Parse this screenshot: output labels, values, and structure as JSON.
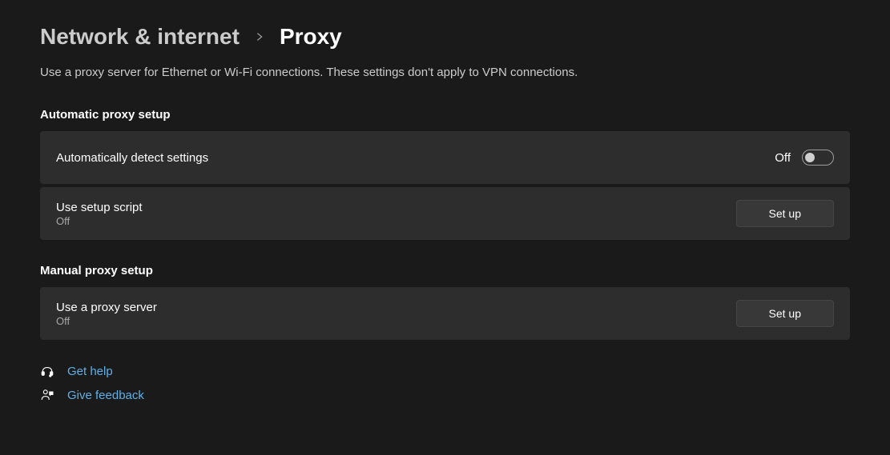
{
  "breadcrumb": {
    "parent": "Network & internet",
    "current": "Proxy"
  },
  "description": "Use a proxy server for Ethernet or Wi-Fi connections. These settings don't apply to VPN connections.",
  "sections": {
    "automatic": {
      "title": "Automatic proxy setup",
      "auto_detect": {
        "label": "Automatically detect settings",
        "state_label": "Off",
        "state": false
      },
      "setup_script": {
        "label": "Use setup script",
        "status": "Off",
        "button": "Set up"
      }
    },
    "manual": {
      "title": "Manual proxy setup",
      "proxy_server": {
        "label": "Use a proxy server",
        "status": "Off",
        "button": "Set up"
      }
    }
  },
  "links": {
    "help": "Get help",
    "feedback": "Give feedback"
  }
}
